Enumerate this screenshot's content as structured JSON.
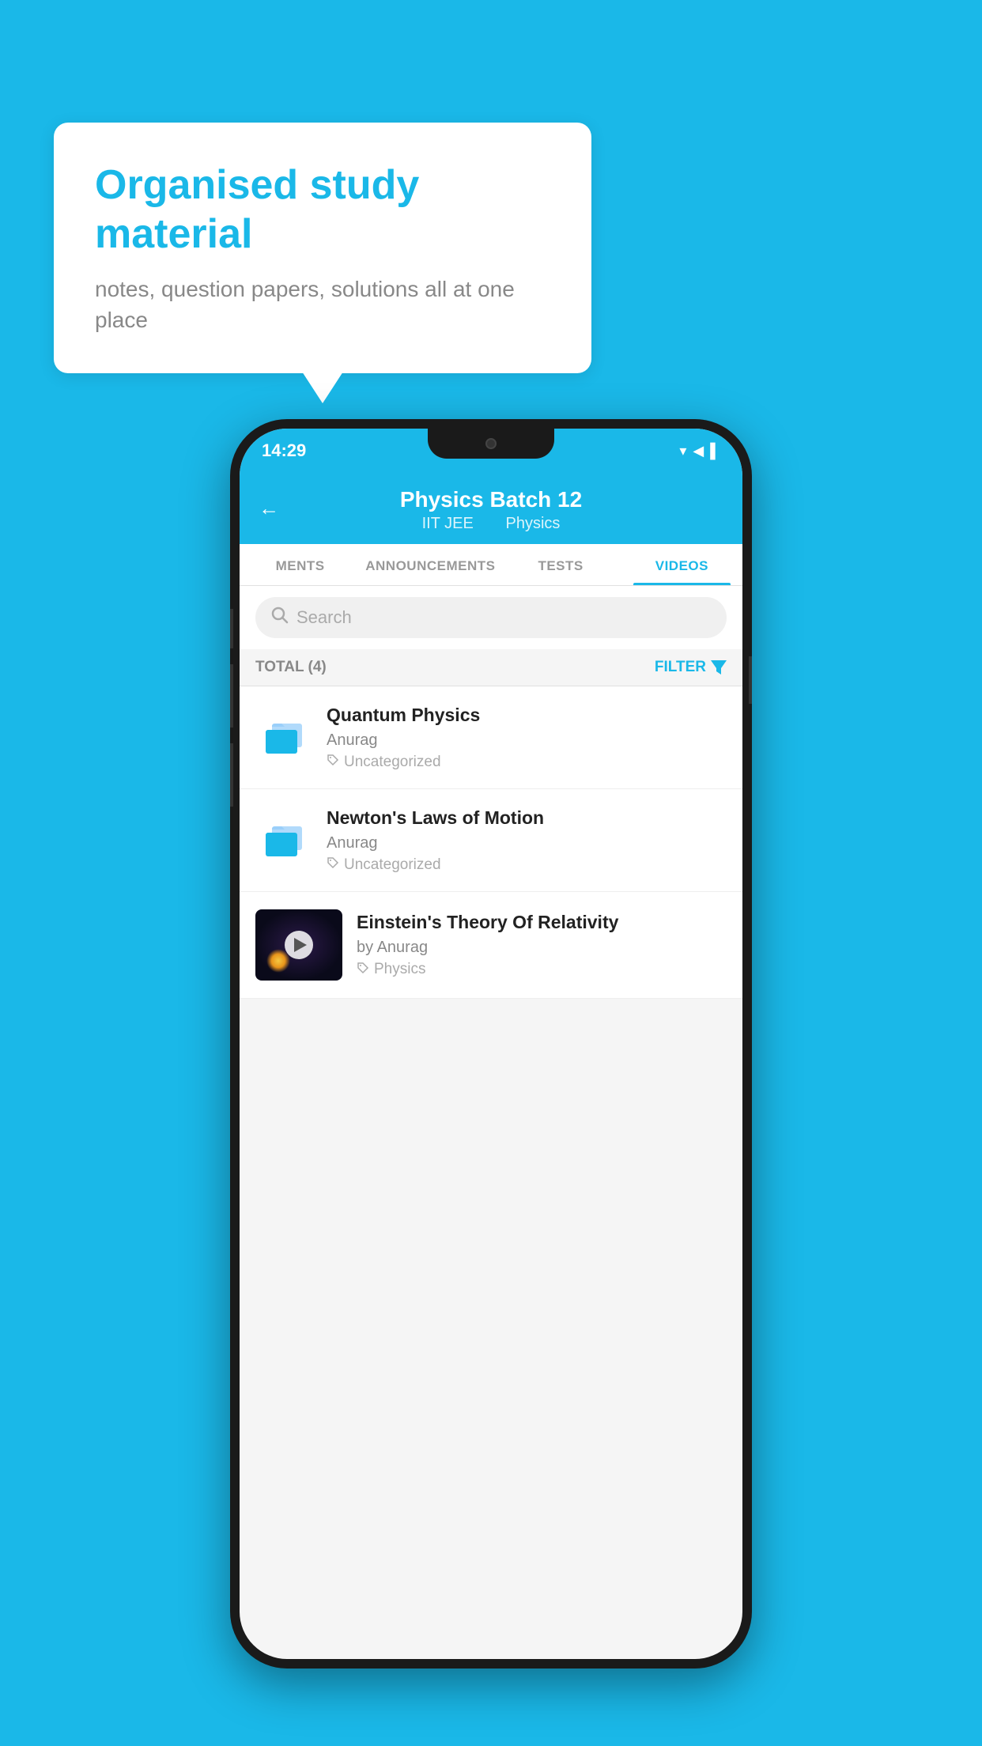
{
  "background_color": "#1ab8e8",
  "speech_bubble": {
    "title": "Organised study material",
    "subtitle": "notes, question papers, solutions all at one place"
  },
  "status_bar": {
    "time": "14:29",
    "icons": "▼◄▌"
  },
  "header": {
    "title": "Physics Batch 12",
    "subtitle_part1": "IIT JEE",
    "subtitle_part2": "Physics",
    "back_label": "←"
  },
  "tabs": [
    {
      "label": "MENTS",
      "active": false
    },
    {
      "label": "ANNOUNCEMENTS",
      "active": false
    },
    {
      "label": "TESTS",
      "active": false
    },
    {
      "label": "VIDEOS",
      "active": true
    }
  ],
  "search": {
    "placeholder": "Search"
  },
  "filter": {
    "total_label": "TOTAL (4)",
    "filter_label": "FILTER"
  },
  "videos": [
    {
      "id": 1,
      "title": "Quantum Physics",
      "author": "Anurag",
      "tag": "Uncategorized",
      "has_thumb": false
    },
    {
      "id": 2,
      "title": "Newton's Laws of Motion",
      "author": "Anurag",
      "tag": "Uncategorized",
      "has_thumb": false
    },
    {
      "id": 3,
      "title": "Einstein's Theory Of Relativity",
      "author": "by Anurag",
      "tag": "Physics",
      "has_thumb": true
    }
  ]
}
